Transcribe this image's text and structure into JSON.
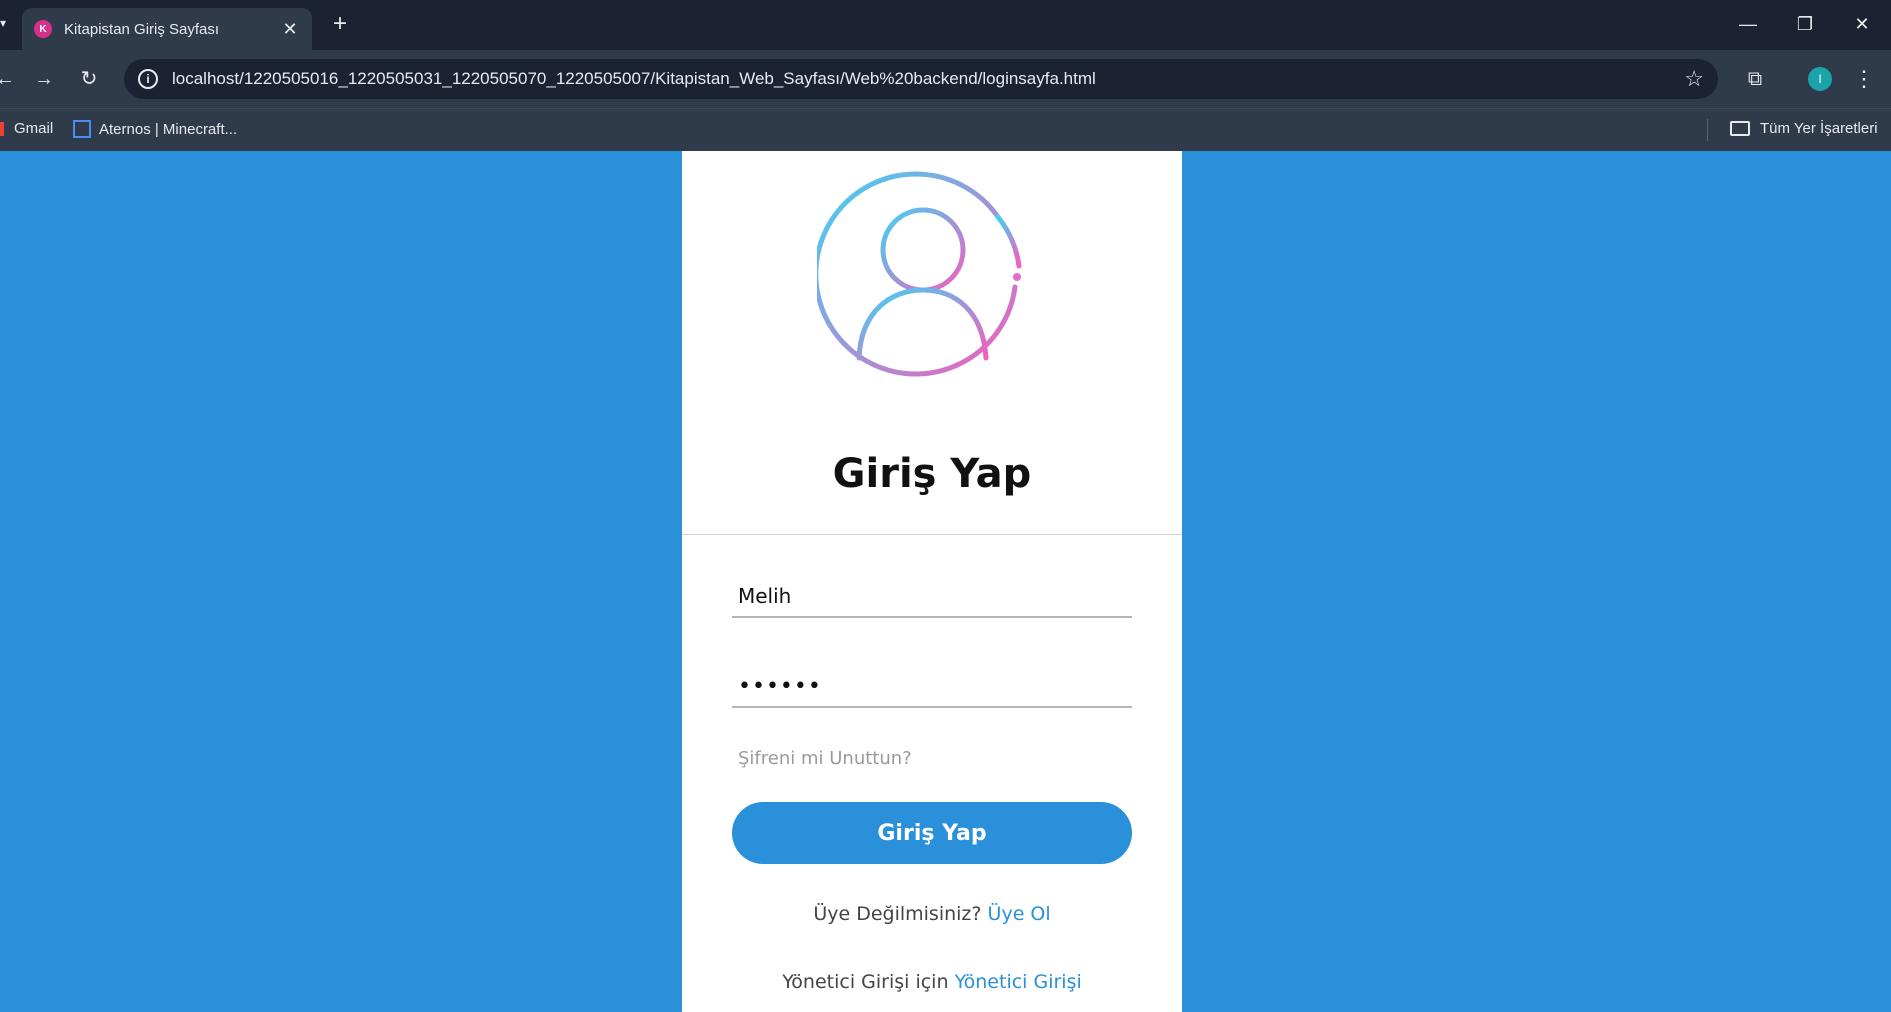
{
  "browser": {
    "tab_title": "Kitapistan Giriş Sayfası",
    "url": "localhost/1220505016_1220505031_1220505070_1220505007/Kitapistan_Web_Sayfası/Web%20backend/loginsayfa.html",
    "profile_initial": "I",
    "bookmarks": [
      {
        "label": "Gmail"
      },
      {
        "label": "Aternos | Minecraft..."
      }
    ],
    "all_bookmarks_label": "Tüm Yer İşaretleri"
  },
  "login": {
    "title": "Giriş Yap",
    "username_value": "Melih",
    "password_masked": "••••••",
    "forgot_label": "Şifreni mi Unuttun?",
    "submit_label": "Giriş Yap",
    "register_prompt": "Üye Değilmisiniz?",
    "register_link": "Üye Ol",
    "admin_prompt": "Yönetici Girişi için",
    "admin_link": "Yönetici Girişi"
  },
  "colors": {
    "page_background": "#2a90da",
    "accent": "#2a90da",
    "avatar_gradient_start": "#40d2f4",
    "avatar_gradient_end": "#f25fbd"
  }
}
